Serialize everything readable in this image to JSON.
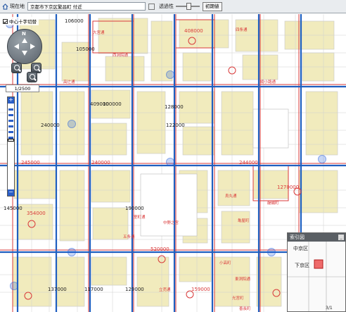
{
  "toolbar": {
    "location_label": "現在地",
    "address": "京都市下京区繁昌町 付近",
    "transparency_label": "透過性",
    "transparency_level": 0.55,
    "reset_label": "初期値"
  },
  "overlay": {
    "center_cross_label": "中心十字切替",
    "compass_north": "N",
    "scale": "1/2500",
    "zoom_plus": "+",
    "zoom_minus": "−",
    "zoom_level": 0.42
  },
  "legend": {
    "title": "索引図",
    "close": "_",
    "ward_label": "中京区",
    "ward2_label": "下京区",
    "street_number": "3/1"
  },
  "map": {
    "labels_black": [
      "106000",
      "105000",
      "409000",
      "128000",
      "100000",
      "122000",
      "240000",
      "145000",
      "190000",
      "137000",
      "117000",
      "129000"
    ],
    "labels_red": [
      "408000",
      "240000",
      "245000",
      "244000",
      "1270000",
      "354000",
      "520000",
      "159000"
    ],
    "street_labels": [
      "大宮通",
      "西洞院通",
      "四条通",
      "高辻通",
      "綾小路通",
      "五条通",
      "烏丸通",
      "中野之宮",
      "室町通",
      "醍醐町",
      "亀屋町",
      "小高町",
      "東洞院通",
      "立売通",
      "光宮町",
      "善長町"
    ]
  },
  "colors": {
    "block": "#f1ebbd",
    "parcel_line": "#c9c9c9",
    "red_line": "#d93a3a",
    "blue_road": "#1f5fc0",
    "toolbar_bg": "#e9ecef"
  }
}
